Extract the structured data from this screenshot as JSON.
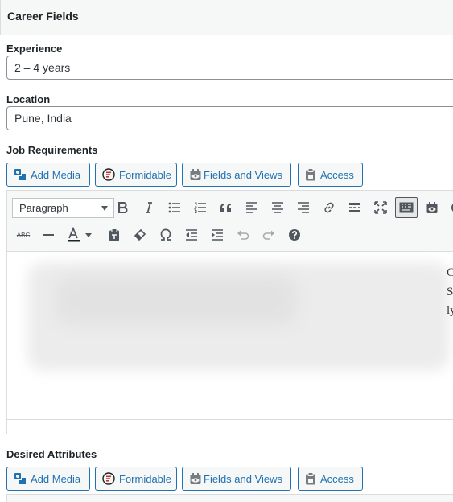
{
  "panel": {
    "title": "Career Fields"
  },
  "fields": {
    "experience": {
      "label": "Experience",
      "value": "2 – 4 years"
    },
    "location": {
      "label": "Location",
      "value": "Pune, India"
    },
    "job_requirements": {
      "label": "Job Requirements"
    },
    "desired_attributes": {
      "label": "Desired Attributes"
    }
  },
  "media_buttons": {
    "add_media": "Add Media",
    "formidable": "Formidable",
    "fields_and_views": "Fields and Views",
    "access": "Access"
  },
  "editor": {
    "format_value": "Paragraph",
    "strike_label": "ABC",
    "content_fragments": [
      "C",
      "S",
      "ly"
    ]
  },
  "colors": {
    "accent": "#2271b1",
    "toolbar_bg": "#f6f7f7",
    "border": "#dcdcde"
  }
}
